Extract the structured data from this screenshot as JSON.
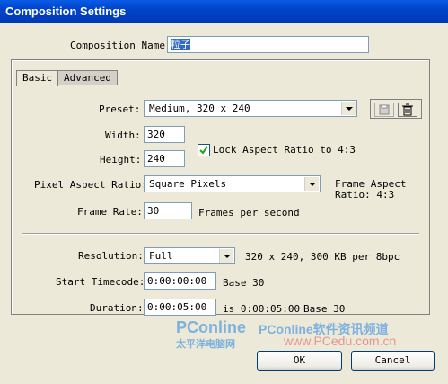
{
  "window": {
    "title": "Composition Settings"
  },
  "composition_name": {
    "label": "Composition Name:",
    "value": "粒子"
  },
  "tabs": [
    {
      "label": "Basic",
      "active": true
    },
    {
      "label": "Advanced",
      "active": false
    }
  ],
  "preset": {
    "label": "Preset:",
    "value": "Medium, 320 x 240"
  },
  "width": {
    "label": "Width:",
    "value": "320"
  },
  "height": {
    "label": "Height:",
    "value": "240"
  },
  "lock_aspect": {
    "label": "Lock Aspect Ratio to 4:3",
    "checked": true
  },
  "pixel_aspect": {
    "label": "Pixel Aspect Ratio:",
    "value": "Square Pixels"
  },
  "frame_aspect": {
    "line1": "Frame Aspect",
    "line2": "Ratio: 4:3"
  },
  "frame_rate": {
    "label": "Frame Rate:",
    "value": "30",
    "unit": "Frames per second"
  },
  "resolution": {
    "label": "Resolution:",
    "value": "Full",
    "info": "320 x 240, 300 KB per 8bpc"
  },
  "start_timecode": {
    "label": "Start Timecode:",
    "value": "0:00:00:00",
    "base": "Base 30"
  },
  "duration": {
    "label": "Duration:",
    "value": "0:00:05:00",
    "info": "is 0:00:05:00",
    "base": "Base 30"
  },
  "buttons": {
    "ok": "OK",
    "cancel": "Cancel"
  },
  "watermark": {
    "brand": "PConline",
    "sub": "太平洋电脑网",
    "slogan": "PConline软件资讯频道",
    "url": "www.PCedu.com.cn"
  }
}
